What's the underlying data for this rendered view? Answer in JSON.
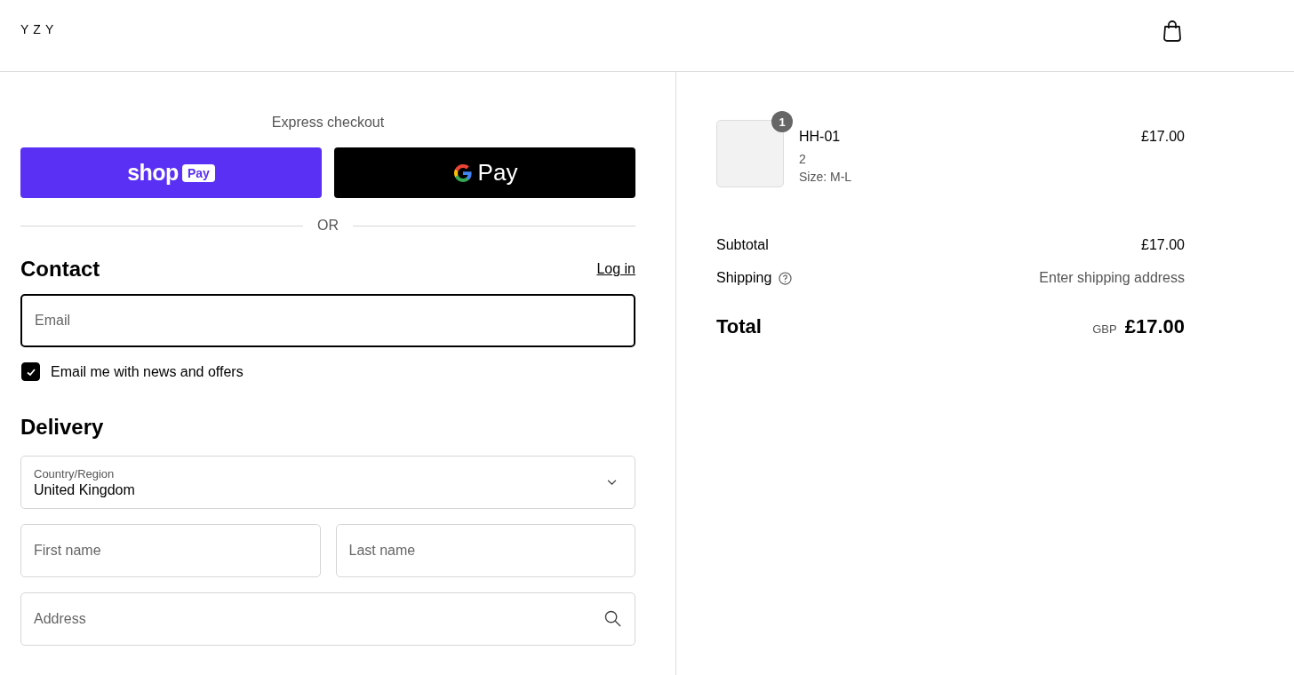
{
  "header": {
    "logo": "YZY"
  },
  "express": {
    "title": "Express checkout",
    "shop_pay": {
      "word": "shop",
      "badge": "Pay"
    },
    "google_pay": {
      "label": "Pay"
    },
    "divider": "OR"
  },
  "contact": {
    "title": "Contact",
    "login": "Log in",
    "email": {
      "placeholder": "Email",
      "focused": true
    },
    "newsletter": {
      "label": "Email me with news and offers",
      "checked": true
    }
  },
  "delivery": {
    "title": "Delivery",
    "country": {
      "label": "Country/Region",
      "value": "United Kingdom"
    },
    "first_name": {
      "placeholder": "First name"
    },
    "last_name": {
      "placeholder": "Last name"
    },
    "address": {
      "placeholder": "Address"
    }
  },
  "cart": {
    "items": [
      {
        "quantity_badge": "1",
        "name": "HH-01",
        "quantity": "2",
        "variant": "Size: M-L",
        "price": "£17.00"
      }
    ],
    "subtotal": {
      "label": "Subtotal",
      "value": "£17.00"
    },
    "shipping": {
      "label": "Shipping",
      "value": "Enter shipping address"
    },
    "total": {
      "label": "Total",
      "currency": "GBP",
      "value": "£17.00"
    }
  }
}
